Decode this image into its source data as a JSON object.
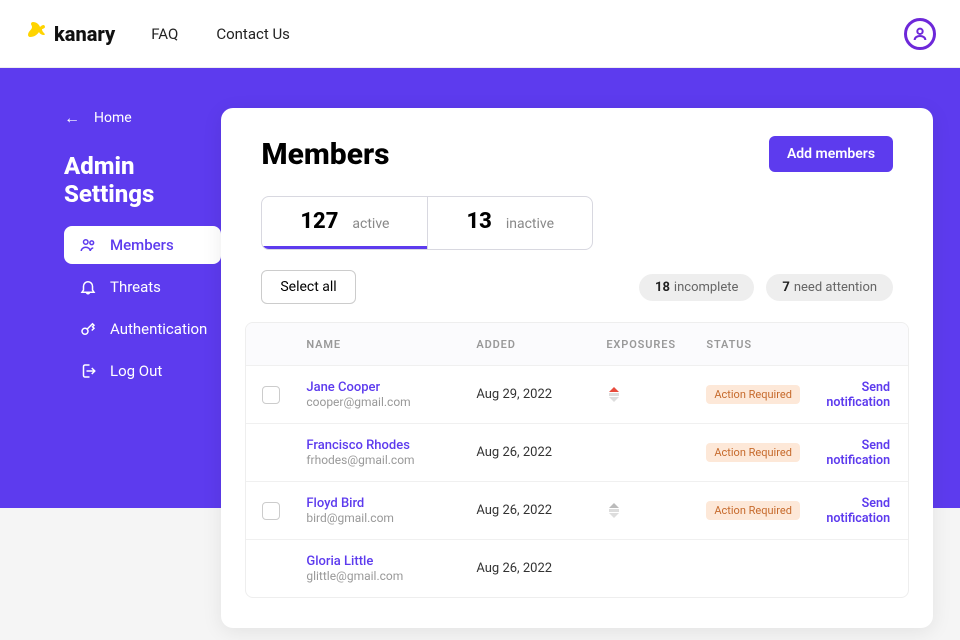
{
  "brand": "kanary",
  "nav": {
    "faq": "FAQ",
    "contact": "Contact Us"
  },
  "breadcrumb": {
    "home": "Home"
  },
  "page_title": "Admin Settings",
  "sidebar": {
    "items": [
      {
        "label": "Members",
        "icon": "group-icon",
        "active": true
      },
      {
        "label": "Threats",
        "icon": "bell-icon",
        "active": false
      },
      {
        "label": "Authentication",
        "icon": "key-icon",
        "active": false
      },
      {
        "label": "Log Out",
        "icon": "logout-icon",
        "active": false
      }
    ]
  },
  "panel": {
    "title": "Members",
    "add_button": "Add members",
    "tabs": [
      {
        "count": "127",
        "label": "active",
        "active": true
      },
      {
        "count": "13",
        "label": "inactive",
        "active": false
      }
    ],
    "select_all": "Select all",
    "filters": [
      {
        "count": "18",
        "label": "incomplete"
      },
      {
        "count": "7",
        "label": "need attention"
      }
    ],
    "columns": {
      "name": "NAME",
      "added": "ADDED",
      "exposures": "EXPOSURES",
      "status": "STATUS"
    },
    "status_badge": "Action Required",
    "notify_text": "Send notification",
    "rows": [
      {
        "name": "Jane Cooper",
        "email": "cooper@gmail.com",
        "added": "Aug 29, 2022",
        "checkbox": true,
        "exposure": "up",
        "status": true
      },
      {
        "name": "Francisco Rhodes",
        "email": "frhodes@gmail.com",
        "added": "Aug 26, 2022",
        "checkbox": false,
        "exposure": "none",
        "status": true
      },
      {
        "name": "Floyd Bird",
        "email": "bird@gmail.com",
        "added": "Aug 26, 2022",
        "checkbox": true,
        "exposure": "mid",
        "status": true
      },
      {
        "name": "Gloria Little",
        "email": "glittle@gmail.com",
        "added": "Aug 26, 2022",
        "checkbox": false,
        "exposure": "none",
        "status": false
      }
    ]
  }
}
